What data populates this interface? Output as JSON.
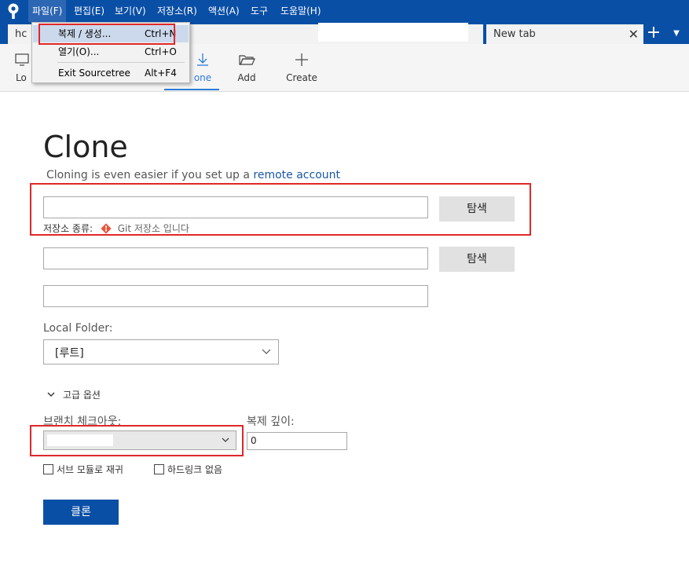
{
  "menubar": {
    "items": [
      "파일(F)",
      "편집(E)",
      "보기(V)",
      "저장소(R)",
      "액션(A)",
      "도구",
      "도움말(H)"
    ]
  },
  "file_menu": {
    "items": [
      {
        "label": "복제 / 생성...",
        "shortcut": "Ctrl+N"
      },
      {
        "label": "열기(O)...",
        "shortcut": "Ctrl+O"
      },
      {
        "label": "Exit Sourcetree",
        "shortcut": "Alt+F4"
      }
    ]
  },
  "tabs": {
    "first_tab_partial": "hc",
    "new_tab": "New tab",
    "close_glyph": "✕",
    "add_glyph": "+",
    "overflow_glyph": "▼"
  },
  "toolbar": {
    "local_partial": "Lo",
    "clone_partial": "one",
    "add": "Add",
    "create": "Create"
  },
  "clone": {
    "title": "Clone",
    "subtitle_prefix": "Cloning is even easier if you set up a ",
    "subtitle_link": "remote account",
    "browse_label": "탐색",
    "repo_type_label": "저장소 종류:",
    "repo_type_value": "Git 저장소 입니다",
    "local_folder_label": "Local Folder:",
    "local_folder_value": "[루트]",
    "advanced_options": "고급 옵션",
    "branch_checkout_label": "브랜치 체크아웃:",
    "clone_depth_label": "복제 깊이:",
    "clone_depth_value": "0",
    "submodules_label": "서브 모듈로 재귀",
    "no_hardlinks_label": "하드링크 없음",
    "clone_button": "클론"
  },
  "colors": {
    "menubar_bg": "#0a4fa6",
    "link": "#1a56a8",
    "highlight_box": "#e02828",
    "primary_button": "#0a4fa6"
  }
}
